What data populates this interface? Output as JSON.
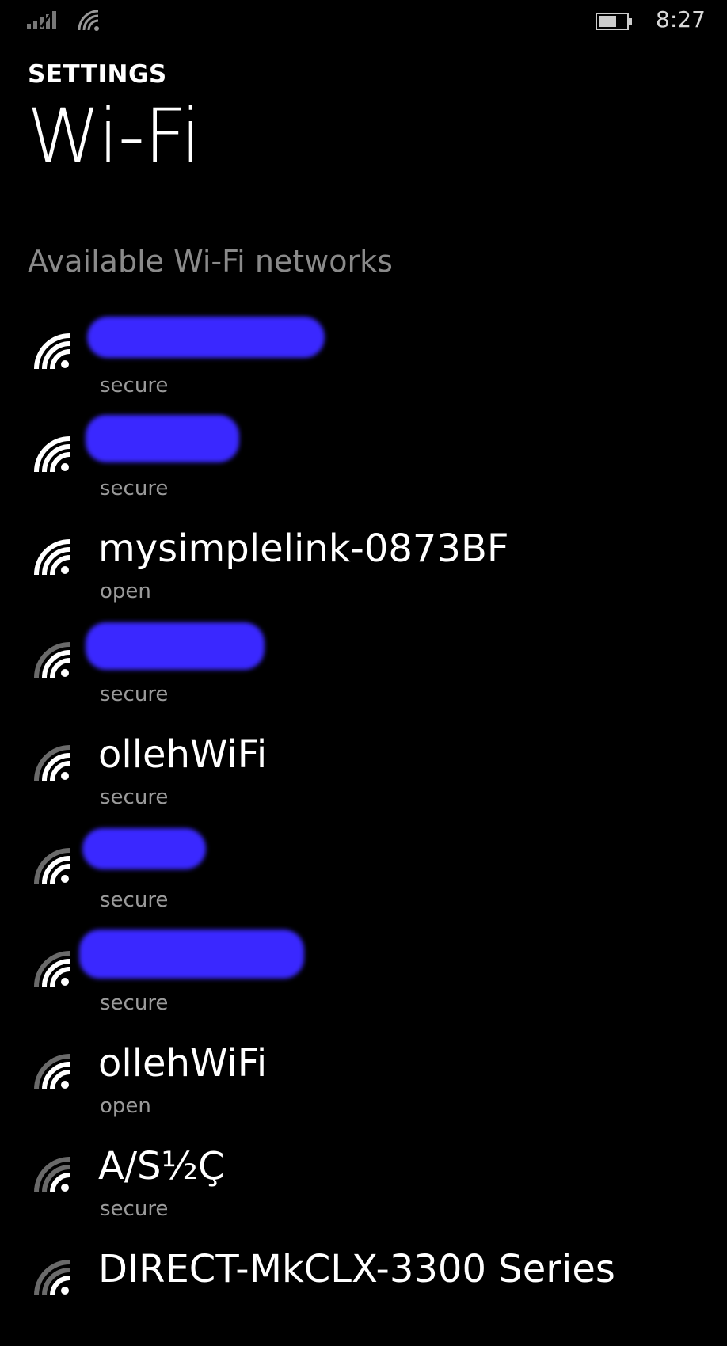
{
  "status_bar": {
    "signal_icon": "cellular-signal-icon",
    "wifi_icon": "wifi-status-icon",
    "battery_icon": "battery-icon",
    "time": "8:27"
  },
  "header": {
    "section": "SETTINGS",
    "title": "Wi-Fi"
  },
  "list": {
    "heading": "Available Wi-Fi networks",
    "networks": [
      {
        "name": "",
        "status": "secure",
        "redacted": true,
        "signal": 4
      },
      {
        "name": "",
        "status": "secure",
        "redacted": true,
        "signal": 4
      },
      {
        "name": "mysimplelink-0873BF",
        "status": "open",
        "redacted": false,
        "signal": 4
      },
      {
        "name": "",
        "status": "secure",
        "redacted": true,
        "signal": 3
      },
      {
        "name": "ollehWiFi",
        "status": "secure",
        "redacted": false,
        "signal": 3
      },
      {
        "name": "",
        "status": "secure",
        "redacted": true,
        "signal": 3
      },
      {
        "name": "",
        "status": "secure",
        "redacted": true,
        "signal": 3
      },
      {
        "name": "ollehWiFi",
        "status": "open",
        "redacted": false,
        "signal": 3
      },
      {
        "name": "A/S½Ç",
        "status": "secure",
        "redacted": false,
        "signal": 2
      },
      {
        "name": "DIRECT-MkCLX-3300 Series",
        "status": "",
        "redacted": false,
        "signal": 2
      }
    ]
  },
  "colors": {
    "background": "#000000",
    "text": "#ffffff",
    "secondary_text": "#9a9a9a",
    "redaction": "#3a28ff"
  }
}
